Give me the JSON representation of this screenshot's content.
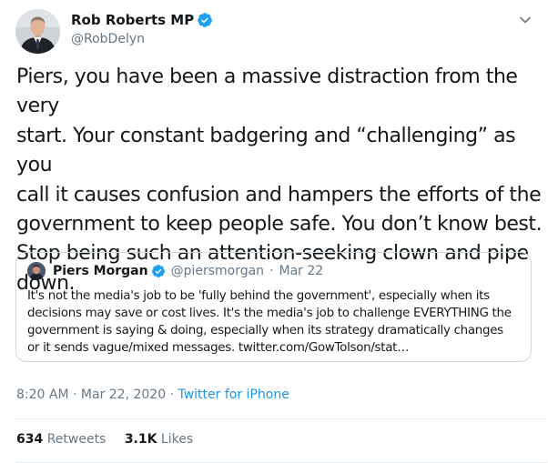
{
  "author": {
    "name": "Rob Roberts MP",
    "handle": "@RobDelyn"
  },
  "tweet": {
    "lines": [
      "Piers, you have been a massive distraction from the very",
      "start. Your constant badgering and “challenging” as you",
      "call it causes confusion and hampers the efforts of the",
      "government to keep people safe. You don’t know best.",
      "Stop being such an attention-seeking clown and pipe",
      "down."
    ]
  },
  "quoted": {
    "name": "Piers Morgan",
    "handle": "@piersmorgan",
    "separator": "·",
    "date": "Mar 22",
    "lines": [
      "It's not the media's job to be 'fully behind the government', especially when its",
      "decisions may save or cost lives. It's the media's job to challenge EVERYTHING the",
      "government is saying & doing, especially when its strategy dramatically changes",
      "or it sends vague/mixed messages. twitter.com/GowTolson/stat…"
    ]
  },
  "meta": {
    "time": "8:20 AM",
    "separator": "·",
    "date": "Mar 22, 2020",
    "source": "Twitter for iPhone"
  },
  "stats": {
    "retweets_count": "634",
    "retweets_label": "Retweets",
    "likes_count": "3.1K",
    "likes_label": "Likes"
  },
  "icons": {
    "verified": "verified-badge-icon",
    "menu": "chevron-down-icon"
  },
  "colors": {
    "verified": "#1da1f2",
    "link": "#1b95e0",
    "secondary_text": "#657786",
    "border": "#ccd6dd"
  }
}
